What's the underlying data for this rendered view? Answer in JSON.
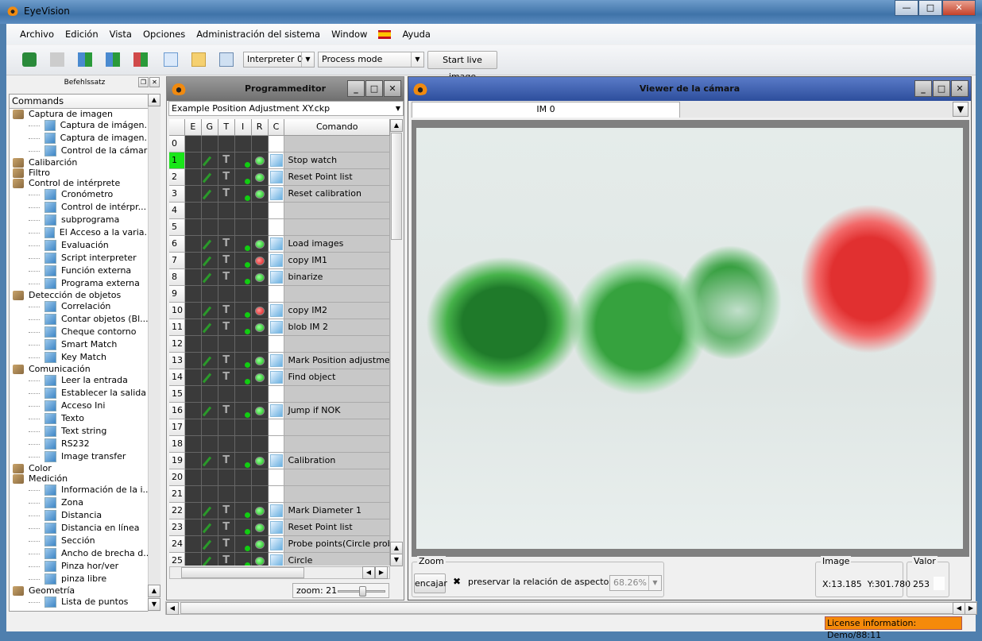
{
  "app": {
    "title": "EyeVision"
  },
  "menu": [
    "Archivo",
    "Edición",
    "Vista",
    "Opciones",
    "Administración del sistema",
    "Window",
    "Ayuda"
  ],
  "toolbar": {
    "interpreter": "Interpreter 0",
    "mode": "Process mode",
    "live": "Start live image"
  },
  "left": {
    "title": "Befehlssatz",
    "header": "Commands",
    "groups": [
      {
        "label": "Captura de imagen",
        "items": [
          "Captura de imágen...",
          "Captura de imagen...",
          "Control de la cámara"
        ]
      },
      {
        "label": "Calibarción",
        "items": []
      },
      {
        "label": "Filtro",
        "items": []
      },
      {
        "label": "Control de intérprete",
        "items": [
          "Cronómetro",
          "Control de intérpr...",
          "subprograma",
          "El Acceso a la varia...",
          "Evaluación",
          "Script interpreter",
          "Función externa",
          "Programa externa"
        ]
      },
      {
        "label": "Detección de objetos",
        "items": [
          "Correlación",
          "Contar objetos (Bl...",
          "Cheque contorno",
          "Smart Match",
          "Key Match"
        ]
      },
      {
        "label": "Comunicación",
        "items": [
          "Leer la entrada",
          "Establecer la salida",
          "Acceso Ini",
          "Texto",
          "Text string",
          "RS232",
          "Image transfer"
        ]
      },
      {
        "label": "Color",
        "items": []
      },
      {
        "label": "Medición",
        "items": [
          "Información de la i...",
          "Zona",
          "Distancia",
          "Distancia en línea",
          "Sección",
          "Ancho de brecha d...",
          "Pinza hor/ver",
          "pinza libre"
        ]
      },
      {
        "label": "Geometría",
        "items": [
          "Lista de puntos"
        ]
      }
    ]
  },
  "editor": {
    "title": "Programmeditor",
    "file": "Example Position Adjustment XY.ckp",
    "columns": [
      "E",
      "G",
      "T",
      "I",
      "R",
      "C",
      "Comando"
    ],
    "rows": [
      {
        "n": "0",
        "cmd": "",
        "active": false,
        "r": ""
      },
      {
        "n": "1",
        "cmd": "Stop watch",
        "r": "green",
        "active": true
      },
      {
        "n": "2",
        "cmd": "Reset Point list",
        "r": "green"
      },
      {
        "n": "3",
        "cmd": "Reset calibration",
        "r": "green"
      },
      {
        "n": "4",
        "cmd": "",
        "r": ""
      },
      {
        "n": "5",
        "cmd": "",
        "r": ""
      },
      {
        "n": "6",
        "cmd": "Load images",
        "r": "green"
      },
      {
        "n": "7",
        "cmd": "copy IM1",
        "r": "red"
      },
      {
        "n": "8",
        "cmd": "binarize",
        "r": "green"
      },
      {
        "n": "9",
        "cmd": "",
        "r": ""
      },
      {
        "n": "10",
        "cmd": "copy IM2",
        "r": "red"
      },
      {
        "n": "11",
        "cmd": "blob IM 2",
        "r": "green"
      },
      {
        "n": "12",
        "cmd": "",
        "r": ""
      },
      {
        "n": "13",
        "cmd": "Mark Position adjustmen",
        "r": "green"
      },
      {
        "n": "14",
        "cmd": "Find object",
        "r": "green"
      },
      {
        "n": "15",
        "cmd": "",
        "r": ""
      },
      {
        "n": "16",
        "cmd": "Jump if NOK",
        "r": "green"
      },
      {
        "n": "17",
        "cmd": "",
        "r": ""
      },
      {
        "n": "18",
        "cmd": "",
        "r": ""
      },
      {
        "n": "19",
        "cmd": "Calibration",
        "r": "green"
      },
      {
        "n": "20",
        "cmd": "",
        "r": ""
      },
      {
        "n": "21",
        "cmd": "",
        "r": ""
      },
      {
        "n": "22",
        "cmd": "Mark Diameter 1",
        "r": "green"
      },
      {
        "n": "23",
        "cmd": "Reset Point list",
        "r": "green"
      },
      {
        "n": "24",
        "cmd": "Probe points(Circle probe",
        "r": "green"
      },
      {
        "n": "25",
        "cmd": "Circle",
        "r": "green"
      }
    ],
    "zoom": "zoom: 21",
    "zoom_value": 21
  },
  "viewer": {
    "title": "Viewer de la cámara",
    "tab": "IM 0",
    "zoom": {
      "legend": "Zoom",
      "fit": "encajar",
      "preserve": "preservar la relación de aspecto",
      "preserve_checked": true,
      "percent": "68.26%"
    },
    "image": {
      "legend": "Image",
      "coords": "X:13.185  Y:301.780"
    },
    "valor": {
      "legend": "Valor",
      "value": "253"
    }
  },
  "status": {
    "license": "License information: Demo/88:11"
  }
}
